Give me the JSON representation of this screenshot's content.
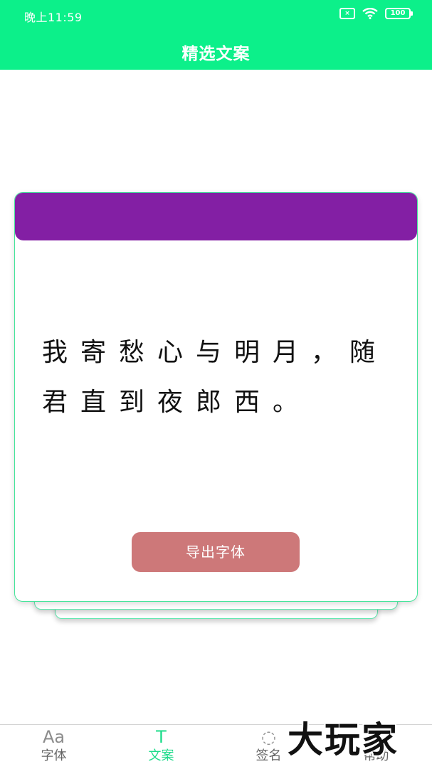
{
  "status_bar": {
    "time": "晚上11:59",
    "battery": "100"
  },
  "app_bar": {
    "title": "精选文案"
  },
  "card": {
    "header_color": "#831fa4",
    "text": "我寄愁心与明月，随君直到夜郎西。",
    "export_label": "导出字体"
  },
  "bottom_nav": {
    "items": [
      {
        "icon": "Aa",
        "icon_name": "font-icon",
        "label": "字体",
        "active": false
      },
      {
        "icon": "T",
        "icon_name": "text-icon",
        "label": "文案",
        "active": true
      },
      {
        "icon": "◌",
        "icon_name": "signature-icon",
        "label": "签名",
        "active": false
      },
      {
        "icon": "?",
        "icon_name": "help-icon",
        "label": "帮助",
        "active": false
      }
    ]
  },
  "colors": {
    "accent": "#0cf08a",
    "active_tab": "#1edc8b",
    "button": "#cd7879"
  },
  "watermark": "大玩家"
}
